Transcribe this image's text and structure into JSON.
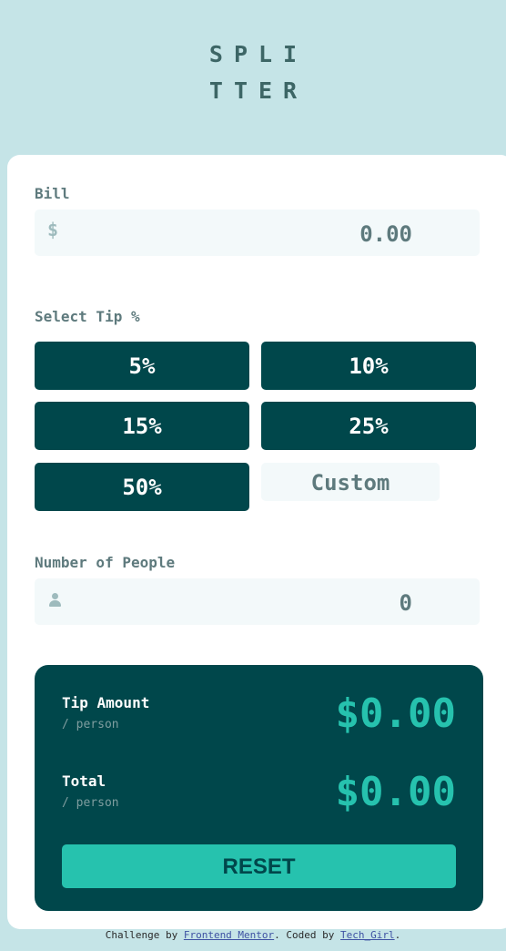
{
  "logo": {
    "line1": "SPLI",
    "line2": "TTER"
  },
  "bill": {
    "label": "Bill",
    "currency_icon": "$",
    "value": "0.00"
  },
  "tip": {
    "label": "Select Tip %",
    "options": [
      "5%",
      "10%",
      "15%",
      "25%",
      "50%"
    ],
    "custom_label": "Custom"
  },
  "people": {
    "label": "Number of People",
    "icon": "person-icon",
    "value": "0"
  },
  "results": {
    "tip_amount_label": "Tip Amount",
    "tip_amount_sub": "/ person",
    "tip_amount_value": "$0.00",
    "total_label": "Total",
    "total_sub": "/ person",
    "total_value": "$0.00",
    "reset_label": "RESET"
  },
  "footer": {
    "prefix": "Challenge by ",
    "link1": "Frontend Mentor",
    "middle": ". Coded by ",
    "link2": "Tech_Girl",
    "suffix": "."
  },
  "colors": {
    "background": "#c5e4e7",
    "primary": "#00474b",
    "accent": "#26c2ae",
    "input_bg": "#f3f9fa"
  }
}
